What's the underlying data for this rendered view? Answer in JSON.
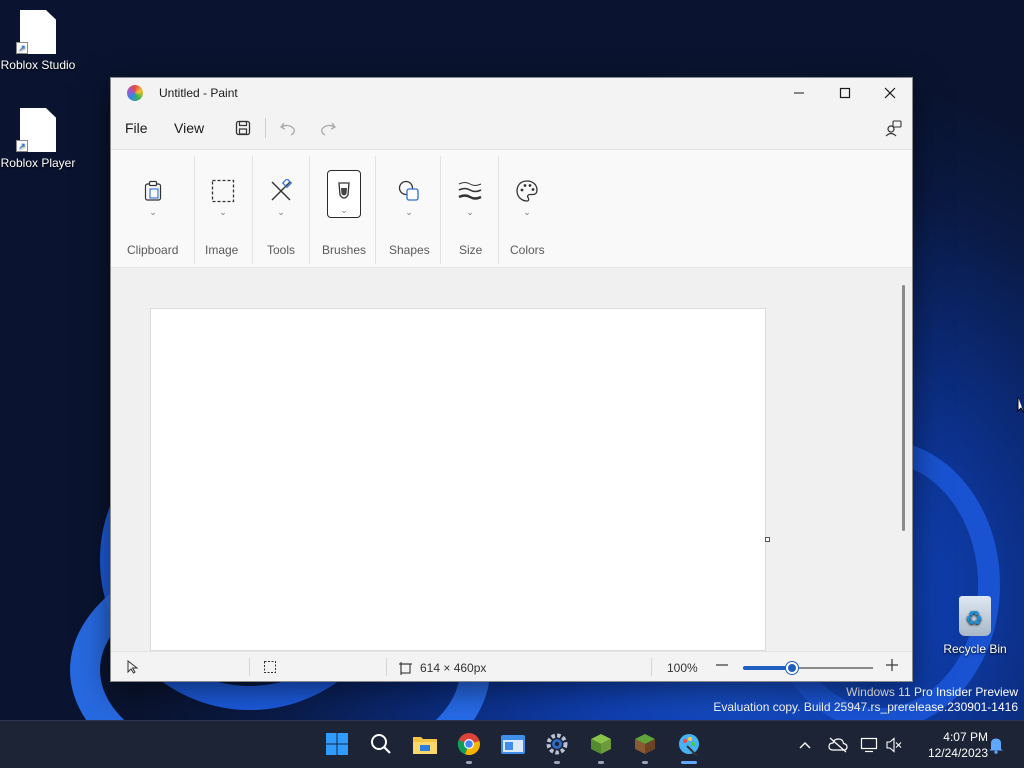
{
  "desktop": {
    "icons": [
      {
        "label": "Roblox Studio"
      },
      {
        "label": "Roblox Player"
      }
    ],
    "recycle_bin": "Recycle Bin",
    "watermark": {
      "line1": "Windows 11 Pro Insider Preview",
      "line2": "Evaluation copy. Build 25947.rs_prerelease.230901-1416"
    }
  },
  "window": {
    "title": "Untitled - Paint",
    "menu": {
      "file": "File",
      "view": "View"
    },
    "ribbon_groups": [
      {
        "label": "Clipboard",
        "icon": "clipboard-icon"
      },
      {
        "label": "Image",
        "icon": "selection-icon"
      },
      {
        "label": "Tools",
        "icon": "tools-icon"
      },
      {
        "label": "Brushes",
        "icon": "brush-icon"
      },
      {
        "label": "Shapes",
        "icon": "shapes-icon"
      },
      {
        "label": "Size",
        "icon": "line-size-icon"
      },
      {
        "label": "Colors",
        "icon": "palette-icon"
      }
    ],
    "status": {
      "canvas_size": "614 × 460px",
      "zoom": "100%",
      "zoom_fraction": 0.38
    }
  },
  "taskbar": {
    "clock_time": "4:07 PM",
    "clock_date": "12/24/2023",
    "accent": "#60a8ff"
  }
}
